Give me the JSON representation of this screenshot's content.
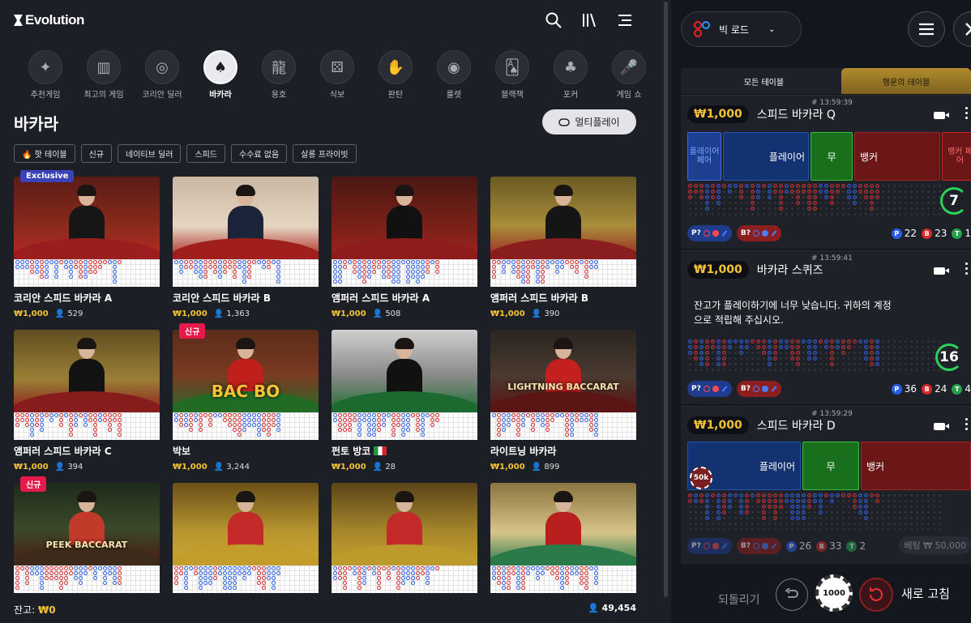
{
  "app": {
    "brand": "Evolution"
  },
  "categories": [
    {
      "label": "추천게임",
      "icon": "sparkle-icon"
    },
    {
      "label": "최고의 게임",
      "icon": "podium-icon"
    },
    {
      "label": "코리안 딜러",
      "icon": "chip-icon"
    },
    {
      "label": "바카라",
      "icon": "baccarat-icon",
      "active": true
    },
    {
      "label": "용호",
      "icon": "dragon-icon"
    },
    {
      "label": "식보",
      "icon": "dice-icon"
    },
    {
      "label": "판탄",
      "icon": "hand-icon"
    },
    {
      "label": "룰렛",
      "icon": "roulette-icon"
    },
    {
      "label": "블랙잭",
      "icon": "blackjack-icon"
    },
    {
      "label": "포커",
      "icon": "poker-icon"
    },
    {
      "label": "게임 쇼",
      "icon": "mic-icon"
    }
  ],
  "page": {
    "title": "바카라",
    "multiplay": "멀티플레이"
  },
  "filters": [
    "🔥 핫 테이블",
    "신규",
    "네이티브 딜러",
    "스피드",
    "수수료 없음",
    "살롱 프라이빗"
  ],
  "games": [
    {
      "name": "코리안 스피드 바카라 A",
      "bet": "₩1,000",
      "players": "529",
      "badge": "Exclusive"
    },
    {
      "name": "코리안 스피드 바카라 B",
      "bet": "₩1,000",
      "players": "1,363"
    },
    {
      "name": "앰퍼러 스피드 바카라 A",
      "bet": "₩1,000",
      "players": "508"
    },
    {
      "name": "앰퍼러 스피드 바카라 B",
      "bet": "₩1,000",
      "players": "390"
    },
    {
      "name": "앰퍼러 스피드 바카라 C",
      "bet": "₩1,000",
      "players": "394"
    },
    {
      "name": "박보",
      "bet": "₩1,000",
      "players": "3,244",
      "badge": "신규",
      "overlay": "BAC BO"
    },
    {
      "name": "펀토 방코",
      "bet": "₩1,000",
      "players": "28"
    },
    {
      "name": "라이트닝 바카라",
      "bet": "₩1,000",
      "players": "899",
      "overlay": "LIGHTNING BACCARAT"
    },
    {
      "name": "",
      "bet": "",
      "players": "",
      "badge": "신규",
      "overlay": "PEEK BACCARAT"
    },
    {
      "name": "",
      "bet": "",
      "players": ""
    },
    {
      "name": "",
      "bet": "",
      "players": ""
    },
    {
      "name": "",
      "bet": "",
      "players": ""
    }
  ],
  "footer": {
    "balance_label": "잔고:",
    "balance": "₩0",
    "players": "49,454"
  },
  "right": {
    "road_select": "빅 로드",
    "tabs": [
      "모든 테이블",
      "행운의 테이블"
    ],
    "tables": [
      {
        "time": "# 13:59:39",
        "bet": "₩1,000",
        "name": "스피드 바카라 Q",
        "pp": "플레이어 페어",
        "player": "플레이어",
        "tie": "무",
        "banker": "뱅커",
        "bp": "뱅커 페어",
        "count": "7",
        "p": "22",
        "b": "23",
        "t": "1",
        "pq": "P?",
        "bq": "B?"
      },
      {
        "time": "# 13:59:41",
        "bet": "₩1,000",
        "name": "바카라 스퀴즈",
        "msg": "잔고가 플레이하기에 너무 낮습니다. 귀하의 계정으로 적립해 주십시오.",
        "count": "16",
        "p": "36",
        "b": "24",
        "t": "4",
        "pq": "P?",
        "bq": "B?"
      },
      {
        "time": "# 13:59:29",
        "bet": "₩1,000",
        "name": "스피드 바카라 D",
        "player": "플레이어",
        "tie": "무",
        "banker": "뱅커",
        "chip": "50k",
        "p": "26",
        "b": "33",
        "t": "2",
        "pq": "P?",
        "bq": "B?",
        "betting": "베팅 ₩ 50,000"
      }
    ],
    "undo": "되돌리기",
    "chip": "1000",
    "refresh": "새로 고침"
  },
  "colors": {
    "accent_gold": "#f2c335",
    "player_blue": "#133271",
    "banker_red": "#6b1717",
    "tie_green": "#19701c"
  }
}
